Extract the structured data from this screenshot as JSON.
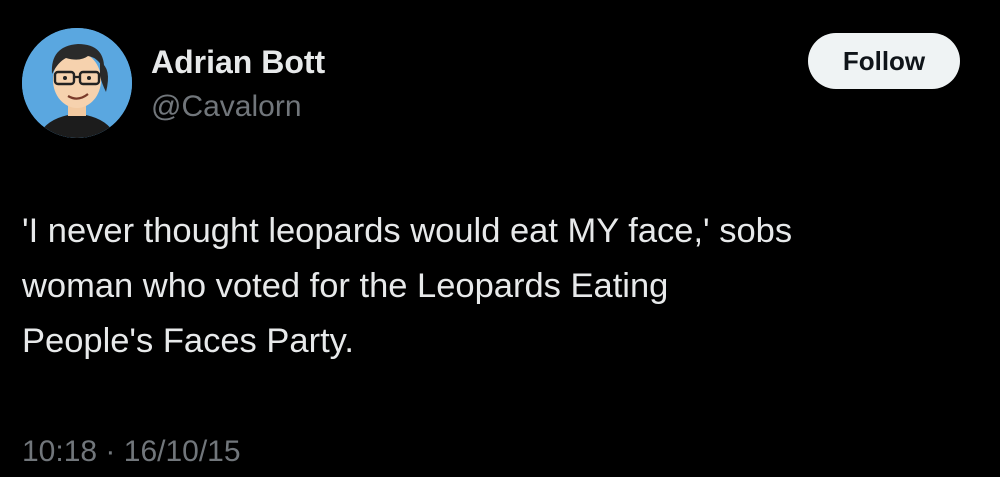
{
  "author": {
    "name": "Adrian Bott",
    "handle": "@Cavalorn",
    "avatar_icon": "cartoon-avatar"
  },
  "follow_button": {
    "label": "Follow"
  },
  "tweet": {
    "lines": [
      "'I never thought leopards would eat MY face,' sobs",
      "woman who voted for the Leopards Eating",
      "People's Faces Party."
    ]
  },
  "meta": {
    "time": "10:18",
    "separator": "·",
    "date": "16/10/15"
  },
  "colors": {
    "background": "#000000",
    "primary_text": "#e7e9ea",
    "secondary_text": "#71767b",
    "button_bg": "#eff3f4"
  }
}
